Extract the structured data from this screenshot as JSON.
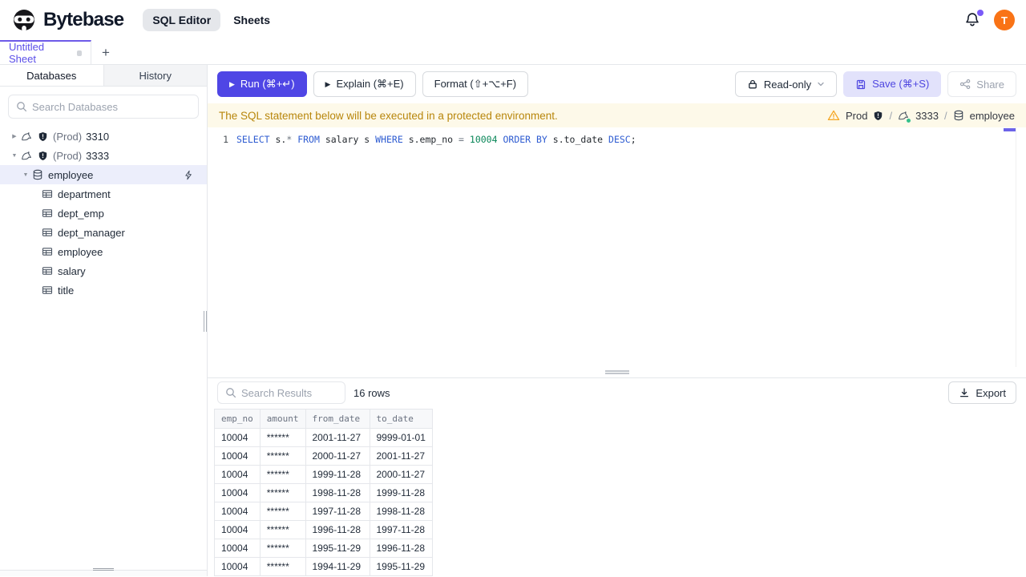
{
  "colors": {
    "accent": "#4f46e5",
    "tab_highlight": "#6d5ae8",
    "notification_dot": "#7a5af8",
    "avatar_bg": "#f97316",
    "warning_bg": "#fdf9e9",
    "warning_text": "#b8860b",
    "selected_row_bg": "#eceefb",
    "save_button_bg": "#e2e2fb"
  },
  "icons": {
    "play": "▶",
    "plus": "+",
    "chevron_collapsed": "▶",
    "chevron_expanded": "▼"
  },
  "header": {
    "brand": "Bytebase",
    "nav_sql_editor": "SQL Editor",
    "nav_sheets": "Sheets",
    "avatar_initial": "T"
  },
  "sheet_tabs": {
    "active_tab": "Untitled Sheet"
  },
  "sidebar": {
    "tab_databases": "Databases",
    "tab_history": "History",
    "search_placeholder": "Search Databases",
    "tree": [
      {
        "kind": "instance",
        "env": "(Prod)",
        "name": "3310",
        "expanded": false
      },
      {
        "kind": "instance",
        "env": "(Prod)",
        "name": "3333",
        "expanded": true
      },
      {
        "kind": "database",
        "name": "employee",
        "expanded": true,
        "selected": true
      },
      {
        "kind": "table",
        "name": "department"
      },
      {
        "kind": "table",
        "name": "dept_emp"
      },
      {
        "kind": "table",
        "name": "dept_manager"
      },
      {
        "kind": "table",
        "name": "employee"
      },
      {
        "kind": "table",
        "name": "salary"
      },
      {
        "kind": "table",
        "name": "title"
      }
    ]
  },
  "toolbar": {
    "run_label": "Run (⌘+↵)",
    "explain_label": "Explain (⌘+E)",
    "format_label": "Format (⇧+⌥+F)",
    "readonly_label": "Read-only",
    "save_label": "Save (⌘+S)",
    "share_label": "Share"
  },
  "banner": {
    "message": "The SQL statement below will be executed in a protected environment.",
    "environment": "Prod",
    "separator": "/",
    "instance": "3333",
    "database": "employee"
  },
  "editor": {
    "line_number": "1",
    "sql_text": "SELECT s.* FROM salary s WHERE s.emp_no = 10004 ORDER BY s.to_date DESC;",
    "sql_tokens": [
      {
        "text": "SELECT",
        "type": "keyword"
      },
      {
        "text": " s.",
        "type": "plain"
      },
      {
        "text": "*",
        "type": "operator"
      },
      {
        "text": " ",
        "type": "plain"
      },
      {
        "text": "FROM",
        "type": "keyword"
      },
      {
        "text": " salary s ",
        "type": "plain"
      },
      {
        "text": "WHERE",
        "type": "keyword"
      },
      {
        "text": " s.emp_no ",
        "type": "plain"
      },
      {
        "text": "=",
        "type": "operator"
      },
      {
        "text": " ",
        "type": "plain"
      },
      {
        "text": "10004",
        "type": "number"
      },
      {
        "text": " ",
        "type": "plain"
      },
      {
        "text": "ORDER BY",
        "type": "keyword"
      },
      {
        "text": " s.to_date ",
        "type": "plain"
      },
      {
        "text": "DESC",
        "type": "keyword"
      },
      {
        "text": ";",
        "type": "plain"
      }
    ]
  },
  "results": {
    "search_placeholder": "Search Results",
    "row_count_label": "16 rows",
    "export_label": "Export",
    "table": {
      "columns": [
        "emp_no",
        "amount",
        "from_date",
        "to_date"
      ],
      "rows": [
        [
          "10004",
          "******",
          "2001-11-27",
          "9999-01-01"
        ],
        [
          "10004",
          "******",
          "2000-11-27",
          "2001-11-27"
        ],
        [
          "10004",
          "******",
          "1999-11-28",
          "2000-11-27"
        ],
        [
          "10004",
          "******",
          "1998-11-28",
          "1999-11-28"
        ],
        [
          "10004",
          "******",
          "1997-11-28",
          "1998-11-28"
        ],
        [
          "10004",
          "******",
          "1996-11-28",
          "1997-11-28"
        ],
        [
          "10004",
          "******",
          "1995-11-29",
          "1996-11-28"
        ],
        [
          "10004",
          "******",
          "1994-11-29",
          "1995-11-29"
        ]
      ]
    }
  }
}
